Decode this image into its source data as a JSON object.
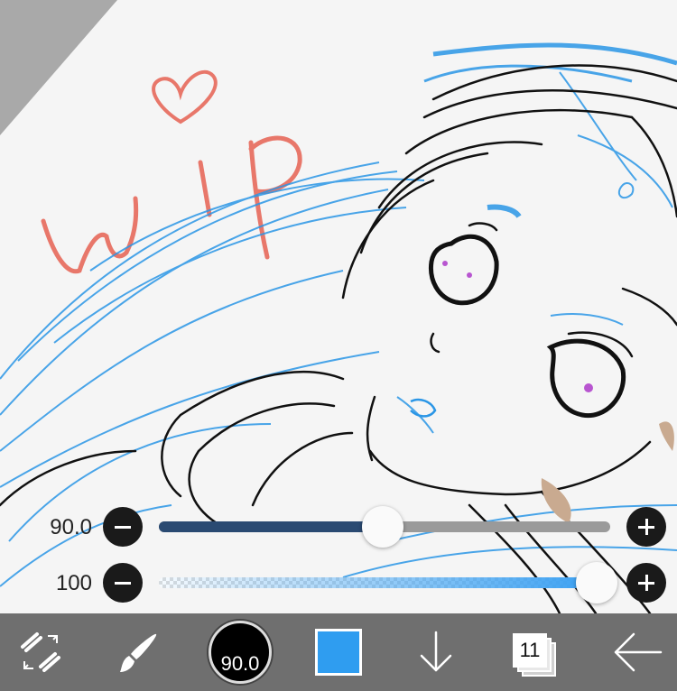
{
  "canvas": {
    "annotation_text": "wip"
  },
  "sliders": {
    "brush_size": {
      "value_label": "90.0",
      "level_percent": 45
    },
    "opacity": {
      "value_label": "100",
      "level_percent": 100
    }
  },
  "toolbar": {
    "brush_size_label": "90.0",
    "current_color": "#2f9df0",
    "layer_count": "11"
  },
  "colors": {
    "slider_fill": "#2a4a72",
    "slider_track": "#9a9a9a",
    "opacity_fill": "#3aa0f2",
    "toolbar_bg": "#6f6f6f",
    "sketch_blue": "#2b96e6",
    "sketch_red": "#e8776a"
  },
  "icons": [
    "transform-icon",
    "brush-icon",
    "download-icon",
    "layers-icon",
    "back-arrow-icon"
  ]
}
